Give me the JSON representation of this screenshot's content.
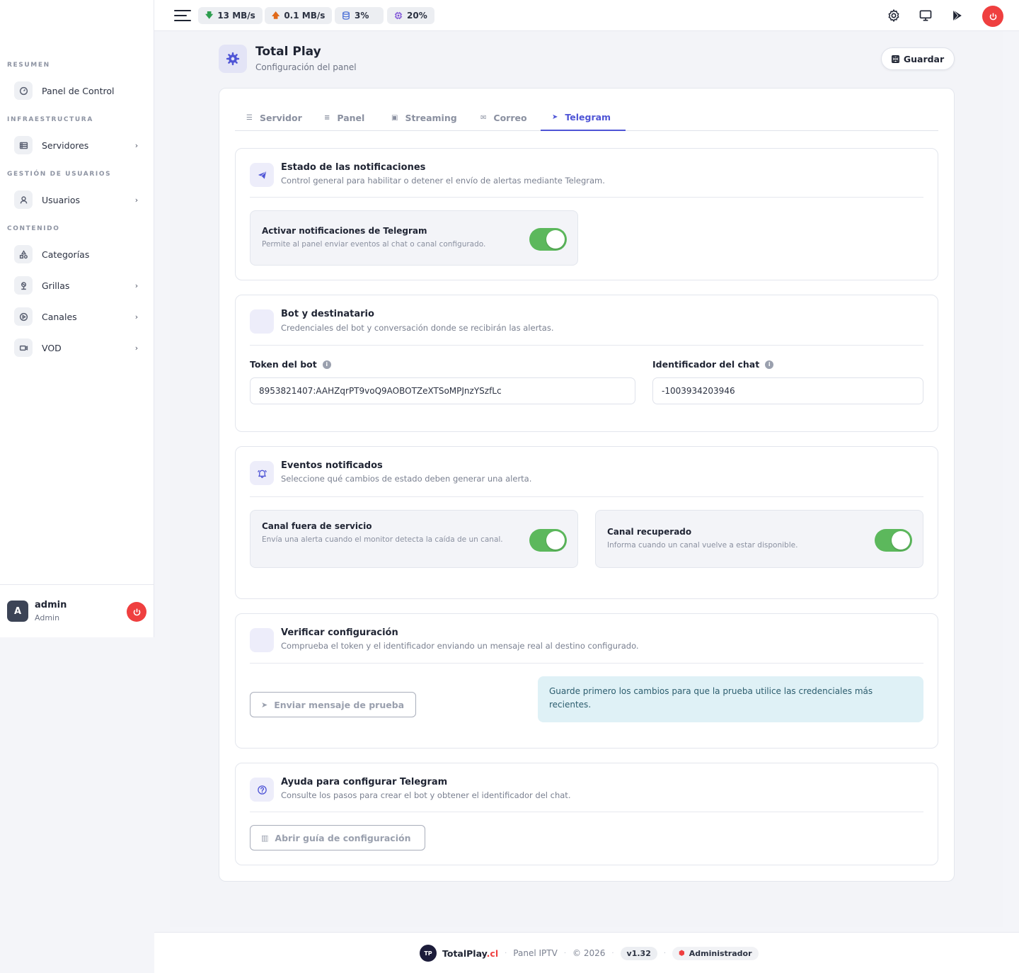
{
  "topbar": {
    "stats": [
      {
        "label": "13 MB/s",
        "icon": "download-arrow-icon",
        "color": "#2e9e4f"
      },
      {
        "label": "0.1 MB/s",
        "icon": "upload-arrow-icon",
        "color": "#e06a1a"
      },
      {
        "label": "3%",
        "icon": "database-icon",
        "color": "#4a6fd6"
      },
      {
        "label": "20%",
        "icon": "cpu-icon",
        "color": "#7b4fd6"
      }
    ],
    "icons": [
      "settings-icon",
      "monitor-icon",
      "play-store-icon",
      "power-icon"
    ]
  },
  "sidebar": {
    "sections": [
      "RESUMEN",
      "INFRAESTRUCTURA",
      "GESTIÓN DE USUARIOS",
      "CONTENIDO"
    ],
    "items": [
      {
        "label": "Panel de Control",
        "icon": "dashboard-icon",
        "chevron": false
      },
      {
        "label": "Servidores",
        "icon": "server-icon",
        "chevron": true
      },
      {
        "label": "Usuarios",
        "icon": "user-icon",
        "chevron": true
      },
      {
        "label": "Categorías",
        "icon": "shapes-icon",
        "chevron": false
      },
      {
        "label": "Grillas",
        "icon": "grid-icon",
        "chevron": true
      },
      {
        "label": "Canales",
        "icon": "play-circle-icon",
        "chevron": true
      },
      {
        "label": "VOD",
        "icon": "video-icon",
        "chevron": true
      }
    ],
    "user": {
      "initial": "A",
      "name": "admin",
      "role": "Admin"
    }
  },
  "header": {
    "title": "Total Play",
    "subtitle": "Configuración del panel",
    "save_label": "Guardar"
  },
  "tabs": [
    {
      "label": "Servidor",
      "icon": "server-icon",
      "active": false
    },
    {
      "label": "Panel",
      "icon": "sliders-icon",
      "active": false
    },
    {
      "label": "Streaming",
      "icon": "stream-icon",
      "active": false
    },
    {
      "label": "Correo",
      "icon": "mail-icon",
      "active": false
    },
    {
      "label": "Telegram",
      "icon": "telegram-icon",
      "active": true
    }
  ],
  "notifications": {
    "title": "Estado de las notificaciones",
    "description": "Control general para habilitar o detener el envío de alertas mediante Telegram.",
    "toggle": {
      "title": "Activar notificaciones de Telegram",
      "description": "Permite al panel enviar eventos al chat o canal configurado.",
      "enabled": true
    }
  },
  "bot": {
    "title": "Bot y destinatario",
    "description": "Credenciales del bot y conversación donde se recibirán las alertas.",
    "token_label": "Token del bot",
    "token_value": "8953821407:AAHZqrPT9voQ9AOBOTZeXTSoMPJnzYSzfLc",
    "chat_label": "Identificador del chat",
    "chat_value": "-1003934203946"
  },
  "events": {
    "title": "Eventos notificados",
    "description": "Seleccione qué cambios de estado deben generar una alerta.",
    "items": [
      {
        "title": "Canal fuera de servicio",
        "description": "Envía una alerta cuando el monitor detecta la caída de un canal.",
        "enabled": true
      },
      {
        "title": "Canal recuperado",
        "description": "Informa cuando un canal vuelve a estar disponible.",
        "enabled": true
      }
    ]
  },
  "verify": {
    "title": "Verificar configuración",
    "description": "Comprueba el token y el identificador enviando un mensaje real al destino configurado.",
    "button_label": "Enviar mensaje de prueba",
    "alert": "Guarde primero los cambios para que la prueba utilice las credenciales más recientes."
  },
  "help": {
    "title": "Ayuda para configurar Telegram",
    "description": "Consulte los pasos para crear el bot y obtener el identificador del chat.",
    "button_label": "Abrir guía de configuración"
  },
  "footer": {
    "logo": "TP",
    "brand": "TotalPlay",
    "brand_suffix": ".cl",
    "product": "Panel IPTV",
    "copyright": "© 2026",
    "version": "v1.32",
    "role": "Administrador"
  },
  "colors": {
    "accent": "#4f55d6",
    "toggle_on": "#5cb85c",
    "danger": "#ef3f3f"
  }
}
